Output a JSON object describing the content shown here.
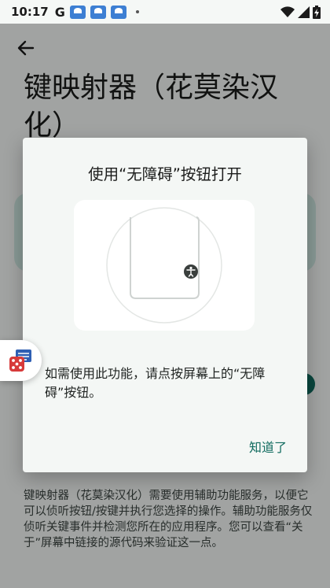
{
  "status_bar": {
    "time": "10:17",
    "g_label": "G",
    "icons": [
      "app-notification-icon",
      "app-notification-icon",
      "app-notification-icon",
      "dot-icon",
      "wifi-icon",
      "signal-icon",
      "battery-charging-icon"
    ]
  },
  "page": {
    "title": "键映射器（花莫染汉化）",
    "description": "键映射器（花莫染汉化）需要使用辅助功能服务，以便它可以侦听按钮/按键并执行您选择的操作。辅助功能服务仅侦听关键事件并检测您所在的应用程序。您可以查看“关于”屏幕中链接的源代码来验证这一点。"
  },
  "dialog": {
    "title": "使用“无障碍”按钮打开",
    "body": "如需使用此功能，请点按屏幕上的“无障碍”按钮。",
    "ok_label": "知道了"
  },
  "colors": {
    "accent": "#106b5f",
    "dialog_bg": "#f4f7f5",
    "scrim": "rgba(0,0,0,0.34)",
    "app_icon": "#3d7fd3"
  }
}
